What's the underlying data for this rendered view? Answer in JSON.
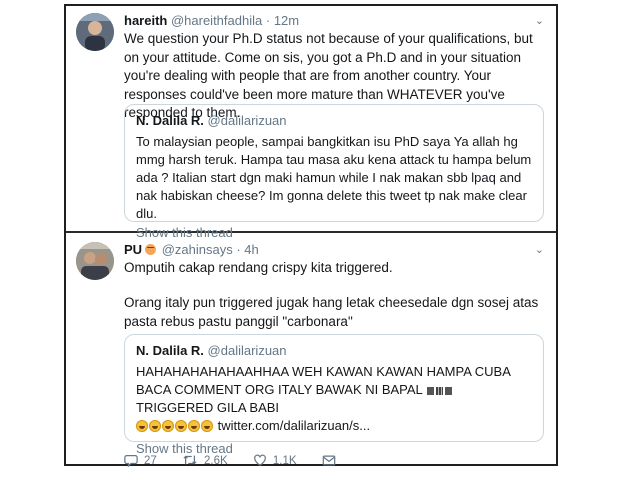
{
  "tweets": [
    {
      "name": "hareith",
      "handle": "@hareithfadhila",
      "dot": "·",
      "time": "12m",
      "text": "We question your Ph.D status not because of your qualifications, but on your attitude. Come on sis, you got a Ph.D and in your situation you're dealing with people that are from another country. Your responses could've been more mature than WHATEVER you've responded to them.",
      "quote": {
        "name": "N. Dalila R.",
        "handle": "@dalilarizuan",
        "text": "To malaysian people, sampai bangkitkan isu PhD saya Ya allah hg mmg harsh teruk. Hampa tau masa aku kena attack tu hampa belum ada ? Italian start dgn maki hamun while I nak makan sbb lpaq and nak habiskan cheese? Im gonna delete this tweet tp nak make clear dlu.",
        "show_thread": "Show this thread"
      }
    },
    {
      "name": "PU",
      "handle": "@zahinsays",
      "dot": "·",
      "time": "4h",
      "text_a": "Omputih cakap rendang crispy kita triggered.",
      "text_b": "Orang italy pun triggered jugak hang letak cheesedale dgn sosej atas pasta rebus pastu panggil \"carbonara\"",
      "quote": {
        "name": "N. Dalila R.",
        "handle": "@dalilarizuan",
        "text_a": "HAHAHAHAHAHAAHHAA WEH KAWAN KAWAN HAMPA CUBA BACA COMMENT ORG ITALY BAWAK NI BAPAL",
        "text_b": "TRIGGERED GILA BABI",
        "link": "twitter.com/dalilarizuan/s...",
        "show_thread": "Show this thread"
      },
      "actions": {
        "replies": "27",
        "retweets": "2.6K",
        "likes": "1.1K"
      }
    }
  ],
  "icons": {
    "reply": "reply-icon",
    "retweet": "retweet-icon",
    "like": "heart-icon",
    "dm": "message-icon",
    "menu": "chevron-down-icon"
  },
  "colors": {
    "text": "#14171a",
    "muted": "#657786",
    "border": "#ccd6dd"
  }
}
